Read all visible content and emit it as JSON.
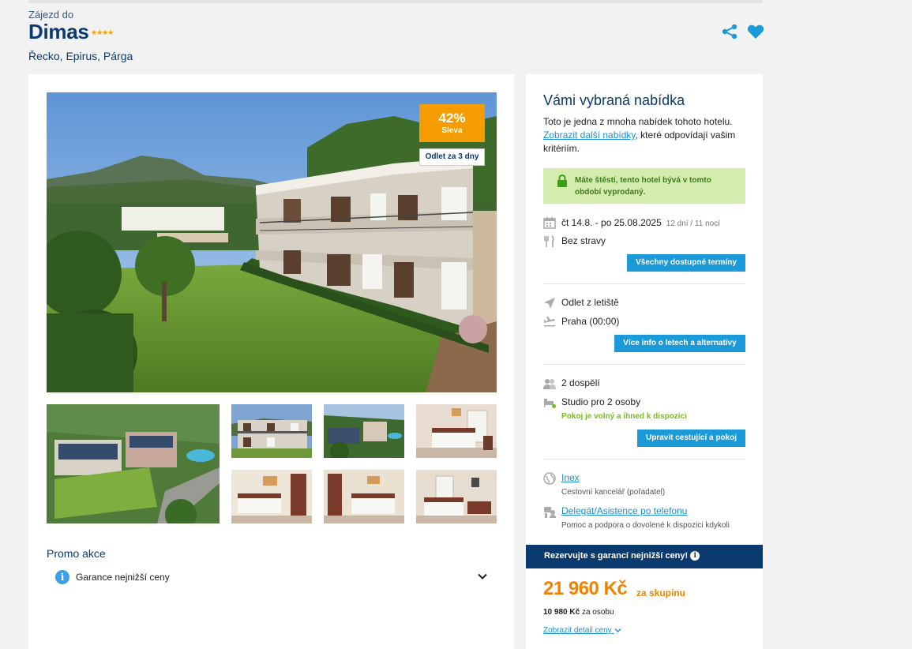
{
  "header": {
    "kicker": "Zájezd do",
    "title": "Dimas",
    "stars": "★★★★",
    "location": "Řecko, Epirus, Párga"
  },
  "gallery": {
    "discount_pct": "42%",
    "discount_label": "Sleva",
    "departure_tag": "Odlet za 3 dny"
  },
  "promo": {
    "title": "Promo akce",
    "item_label": "Garance nejnižší ceny",
    "info_glyph": "i"
  },
  "offer": {
    "title": "Vámi vybraná nabídka",
    "desc_pre": "Toto je jedna z mnoha nabídek tohoto hotelu.",
    "desc_link": "Zobrazit další nabídky",
    "desc_post": ", které odpovídají vašim kritériím.",
    "lucky": "Máte štěstí, tento hotel bývá v tomto období vyprodaný.",
    "dates": "čt 14.8. - po 25.08.2025",
    "dates_sub": "12 dní / 11 nocí",
    "board": "Bez stravy",
    "all_dates_button": "Všechny dostupné termíny",
    "departure_label": "Odlet z letiště",
    "departure_airport": "Praha (00:00)",
    "flight_info_button": "Více info o letech a alternativy",
    "travellers": "2 dospělí",
    "room": "Studio pro 2 osoby",
    "room_status": "Pokoj je volný a ihned k dispozici",
    "edit_room_button": "Upravit cestující a pokoj",
    "operator_link": "Inex",
    "operator_sub": "Cestovní kancelář (pořadatel)",
    "assist_link": "Delegát/Asistence po telefonu",
    "assist_sub": "Pomoc a podpora o dovolené k dispozici kdykoli"
  },
  "pricing": {
    "guarantee": "Rezervujte s garancí nejnižší ceny!",
    "guarantee_glyph": "i",
    "total": "21 960 Kč",
    "total_suffix": "za skupinu",
    "per_person_value": "10 980 Kč",
    "per_person_suffix": "za osobu",
    "detail_link": "Zobrazit detail ceny"
  },
  "colors": {
    "brand_navy": "#0b3a6e",
    "accent_blue": "#1a9ad8",
    "discount_orange": "#f59c00",
    "price_orange": "#f08200",
    "success_green": "#7cbc1c"
  }
}
